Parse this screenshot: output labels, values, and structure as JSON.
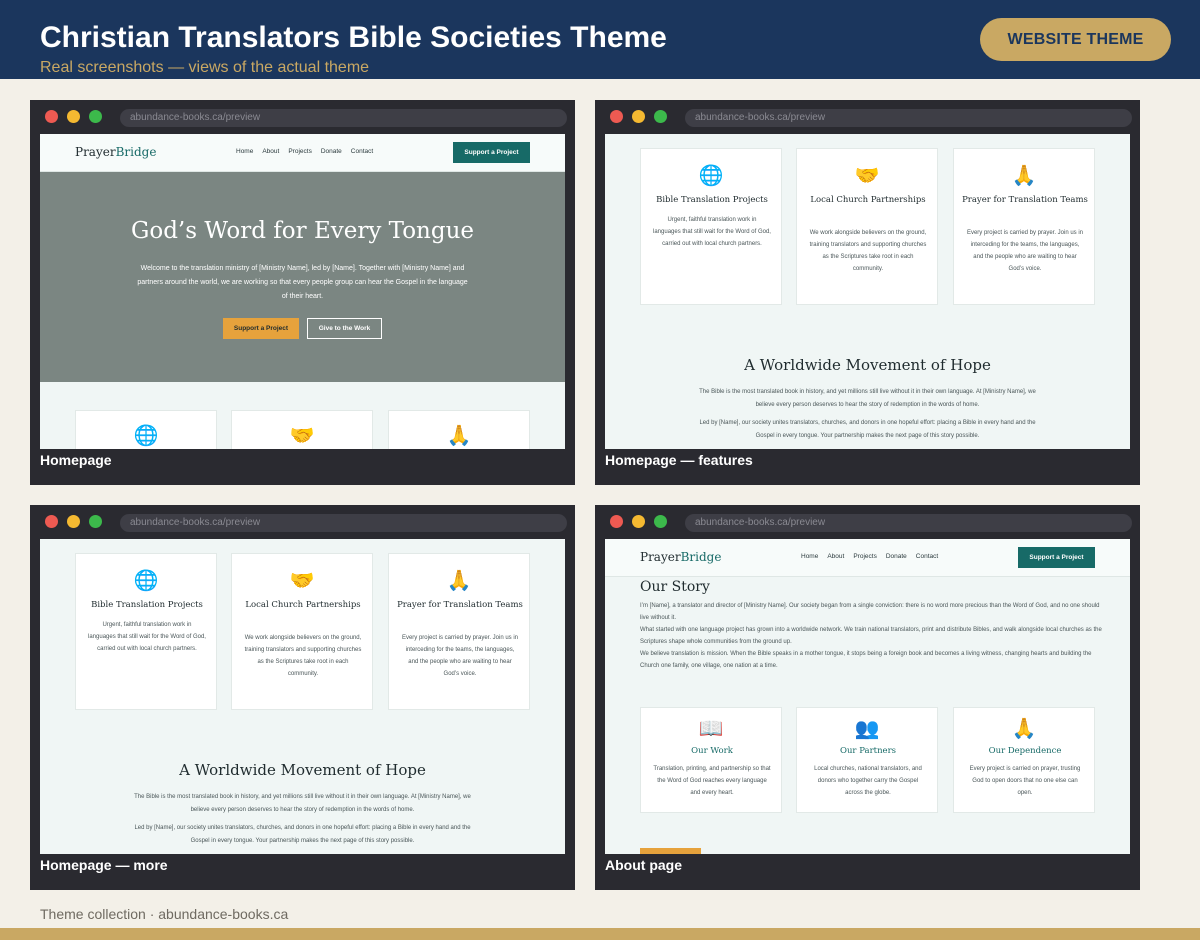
{
  "header": {
    "title": "Christian Translators Bible Societies Theme",
    "subtitle": "Real screenshots — views of the actual theme",
    "badge": "WEBSITE THEME"
  },
  "footer": {
    "text": "Theme collection · abundance-books.ca"
  },
  "colors": {
    "navy": "#1b365d",
    "gold": "#c9a863",
    "teal": "#176a67",
    "orange": "#e6a23c"
  },
  "site": {
    "logo_a": "Prayer",
    "logo_b": "Bridge",
    "nav": [
      "Home",
      "About",
      "Projects",
      "Donate",
      "Contact"
    ],
    "cta": "Support a Project",
    "hero_title": "God’s Word for Every Tongue",
    "hero_text": "Welcome to the translation ministry of [Ministry Name], led by [Name]. Together with [Ministry Name] and partners around the world, we are working so that every people group can hear the Gospel in the language of their heart.",
    "hero_btn1": "Support a Project",
    "hero_btn2": "Give to the Work",
    "features": [
      {
        "icon": "globe-icon",
        "title": "Bible Translation Projects",
        "text": "Urgent, faithful translation work in languages that still wait for the Word of God, carried out with local church partners."
      },
      {
        "icon": "handshake-icon",
        "title": "Local Church Partnerships",
        "text": "We work alongside believers on the ground, training translators and supporting churches as the Scriptures take root in each community."
      },
      {
        "icon": "praying-hands-icon",
        "title": "Prayer for Translation Teams",
        "text": "Every project is carried by prayer. Join us in interceding for the teams, the languages, and the people who are waiting to hear God’s voice."
      }
    ],
    "movement_title": "A Worldwide Movement of Hope",
    "movement_p1": "The Bible is the most translated book in history, and yet millions still live without it in their own language. At [Ministry Name], we believe every person deserves to hear the story of redemption in the words of home.",
    "movement_p2": "Led by [Name], our society unites translators, churches, and donors in one hopeful effort: placing a Bible in every hand and the Gospel in every tongue. Your partnership makes the next page of this story possible.",
    "story_title": "Our Story",
    "story_p1": "I’m [Name], a translator and director of [Ministry Name]. Our society began from a single conviction: there is no word more precious than the Word of God, and no one should live without it.",
    "story_p2": "What started with one language project has grown into a worldwide network. We train national translators, print and distribute Bibles, and walk alongside local churches as the Scriptures shape whole communities from the ground up.",
    "story_p3": "We believe translation is mission. When the Bible speaks in a mother tongue, it stops being a foreign book and becomes a living witness, changing hearts and building the Church one family, one village, one nation at a time.",
    "about_cards": [
      {
        "icon": "bible-icon",
        "title": "Our Work",
        "text": "Translation, printing, and partnership so that the Word of God reaches every language and every heart."
      },
      {
        "icon": "people-icon",
        "title": "Our Partners",
        "text": "Local churches, national translators, and donors who together carry the Gospel across the globe."
      },
      {
        "icon": "praying-hands-icon",
        "title": "Our Dependence",
        "text": "Every project is carried on prayer, trusting God to open doors that no one else can open."
      }
    ]
  },
  "windows": [
    {
      "url": "abundance-books.ca/preview",
      "caption": "Homepage"
    },
    {
      "url": "abundance-books.ca/preview",
      "caption": "Homepage — features"
    },
    {
      "url": "abundance-books.ca/preview",
      "caption": "Homepage — more"
    },
    {
      "url": "abundance-books.ca/preview",
      "caption": "About page"
    }
  ]
}
